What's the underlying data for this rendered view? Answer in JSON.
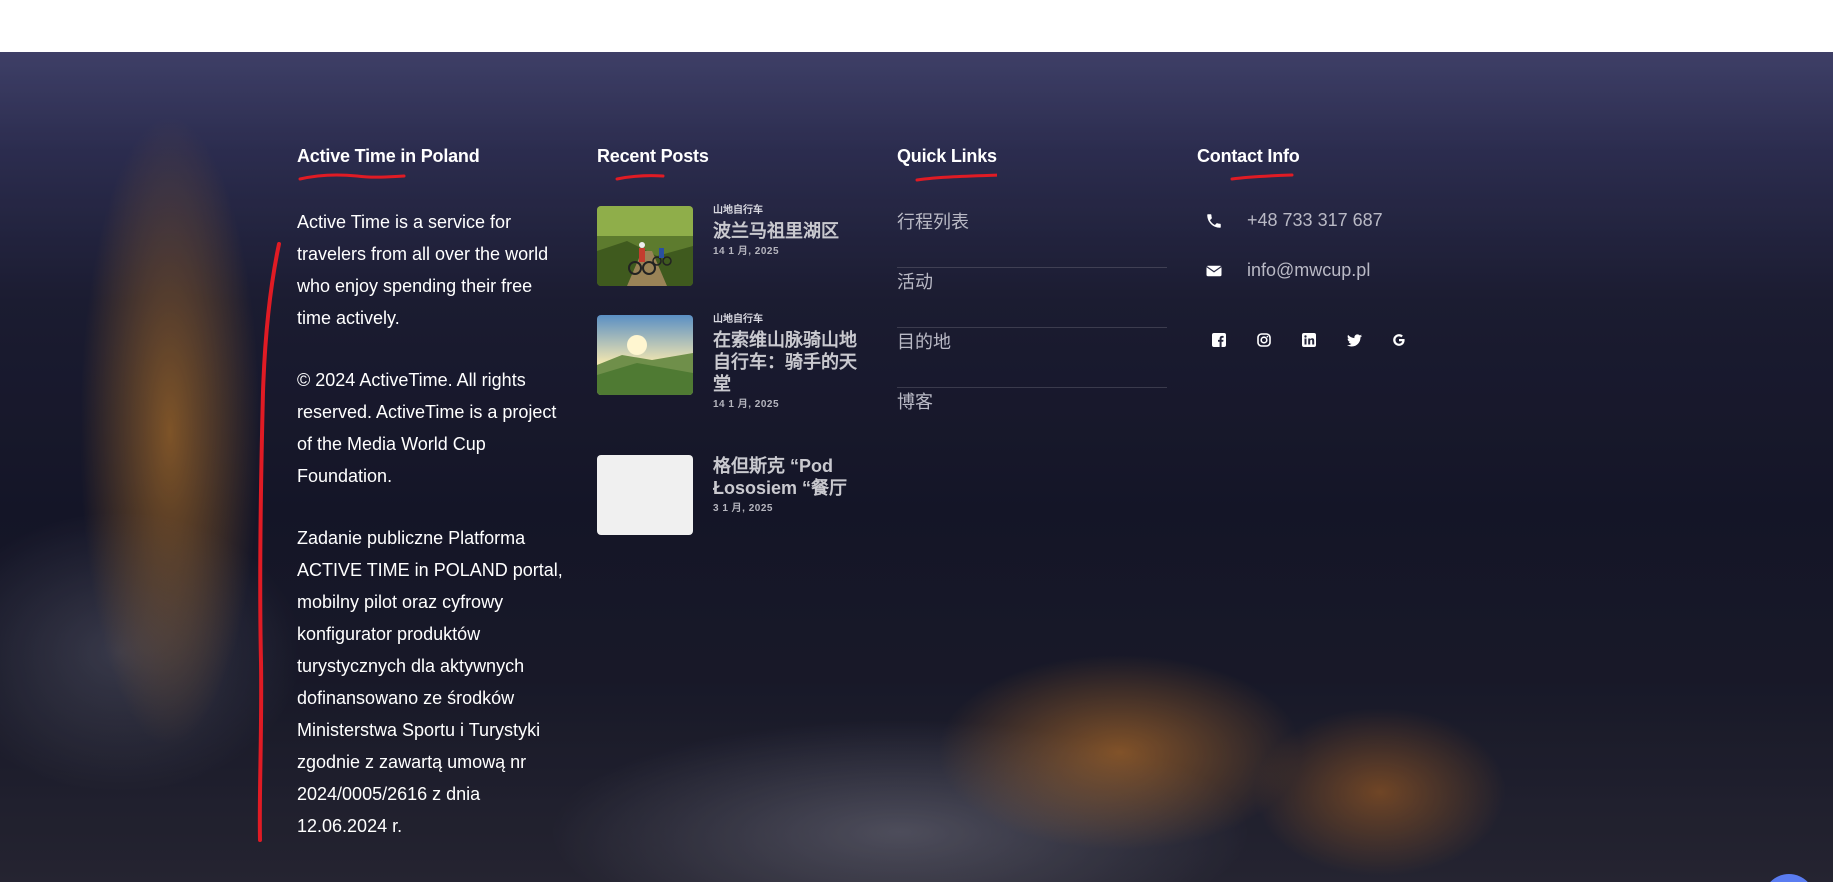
{
  "colors": {
    "accent_red": "#e01b24",
    "scroll_button": "#5a7cf0",
    "heading": "#ffffff",
    "muted_text": "#b9b9c5"
  },
  "about": {
    "title": "Active Time in Poland",
    "paragraphs": [
      "Active Time is a service for travelers from all over the world who enjoy spending their free time actively.",
      "© 2024 ActiveTime. All rights reserved. ActiveTime is a project of the Media World Cup Foundation.",
      "Zadanie publiczne Platforma ACTIVE TIME in POLAND portal, mobilny pilot oraz cyfrowy konfigurator produktów turystycznych dla aktywnych dofinansowano ze środków Ministerstwa Sportu i Turystyki zgodnie z zawartą umową nr 2024/0005/2616 z dnia 12.06.2024 r."
    ]
  },
  "recent_posts": {
    "title": "Recent Posts",
    "posts": [
      {
        "category": "山地自行车",
        "title": "波兰马祖里湖区",
        "date": "14 1 月, 2025"
      },
      {
        "category": "山地自行车",
        "title": "在索维山脉骑山地自行车：骑手的天堂",
        "date": "14 1 月, 2025"
      },
      {
        "category": "",
        "title": "格但斯克 “Pod Łososiem “餐厅",
        "date": "3 1 月, 2025"
      }
    ]
  },
  "quick_links": {
    "title": "Quick Links",
    "items": [
      "行程列表",
      "活动",
      "目的地",
      "博客"
    ]
  },
  "contact": {
    "title": "Contact Info",
    "phone": "+48 733 317 687",
    "email": "info@mwcup.pl",
    "socials": [
      "facebook-icon",
      "instagram-icon",
      "linkedin-icon",
      "twitter-icon",
      "google-icon"
    ]
  },
  "scroll_top": {
    "icon": "arrow-up-icon"
  }
}
